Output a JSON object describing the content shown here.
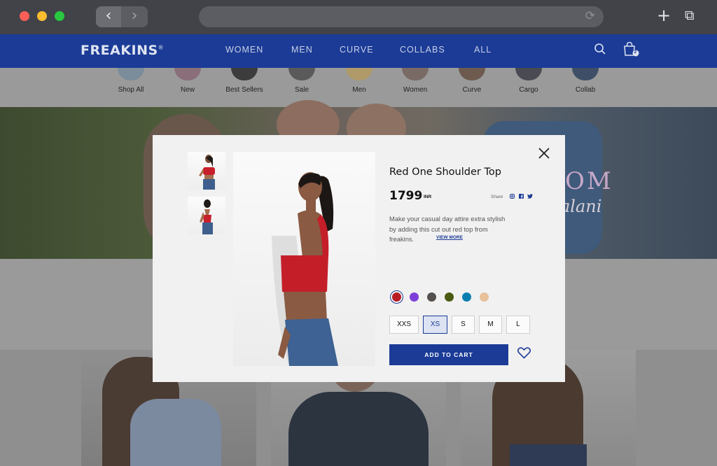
{
  "browser": {
    "back_glyph": "‹",
    "forward_glyph": "›",
    "reload_glyph": "⟳",
    "newtab_glyph": "+",
    "tabs_glyph": "⧉",
    "icons": [
      "back-icon",
      "forward-icon",
      "reload-icon",
      "plus-icon",
      "tabs-icon"
    ]
  },
  "site": {
    "logo": "FREAKINS",
    "logo_mark": "®",
    "nav": [
      "WOMEN",
      "MEN",
      "CURVE",
      "COLLABS",
      "ALL"
    ],
    "cart_count": "2",
    "brand_color": "#1b3b96"
  },
  "categories": [
    "Shop All",
    "New",
    "Best Sellers",
    "Sale",
    "Men",
    "Women",
    "Curve",
    "Cargo",
    "Collab"
  ],
  "hero": {
    "text_line1": "OM",
    "text_line2": "alani"
  },
  "product": {
    "title": "Red One Shoulder Top",
    "price": "1799",
    "currency": "INR",
    "share_label": "Share",
    "share_icons": [
      "instagram-icon",
      "facebook-icon",
      "twitter-icon"
    ],
    "description": "Make your casual day attire extra stylish by adding this cut out red top from freakins.",
    "view_more": "VIEW MORE",
    "colors": [
      "#b81c25",
      "#7e3fd9",
      "#54504e",
      "#4a5a12",
      "#0b7fb0",
      "#e8c09a"
    ],
    "selected_color_index": 0,
    "sizes": [
      "XXS",
      "XS",
      "S",
      "M",
      "L"
    ],
    "selected_size": "XS",
    "add_to_cart": "ADD TO CART",
    "wishlist_icon": "heart-icon",
    "close_icon": "close-icon"
  }
}
